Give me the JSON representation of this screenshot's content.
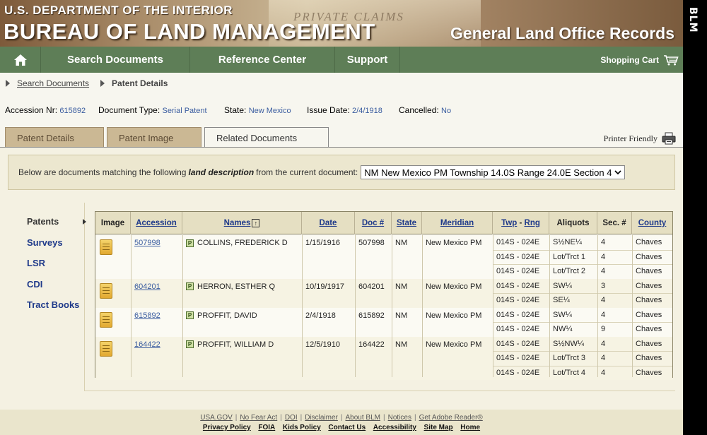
{
  "header": {
    "department": "U.S. DEPARTMENT OF THE INTERIOR",
    "bureau": "BUREAU OF LAND MANAGEMENT",
    "site": "General Land Office Records",
    "background_script": "PRIVATE CLAIMS"
  },
  "side_mark": "BLM",
  "nav": {
    "home_icon": "house-icon",
    "items": [
      "Search Documents",
      "Reference Center",
      "Support"
    ],
    "cart": "Shopping Cart"
  },
  "breadcrumb": {
    "link": "Search Documents",
    "current": "Patent Details"
  },
  "meta": {
    "accession_label": "Accession Nr:",
    "accession": "615892",
    "doctype_label": "Document Type:",
    "doctype": "Serial Patent",
    "state_label": "State:",
    "state": "New Mexico",
    "issue_label": "Issue Date:",
    "issue": "2/4/1918",
    "cancelled_label": "Cancelled:",
    "cancelled": "No"
  },
  "tabs": [
    "Patent Details",
    "Patent Image",
    "Related Documents"
  ],
  "printer_friendly": "Printer Friendly",
  "land_description": {
    "prefix": "Below are documents matching the following",
    "emphasis": "land description",
    "suffix": "from the current document:",
    "selected": "NM New Mexico PM Township 14.0S Range 24.0E Section 4"
  },
  "sidenav": [
    "Patents",
    "Surveys",
    "LSR",
    "CDI",
    "Tract Books"
  ],
  "table": {
    "headers": {
      "image": "Image",
      "accession": "Accession",
      "names": "Names",
      "date": "Date",
      "doc": "Doc #",
      "state": "State",
      "meridian": "Meridian",
      "twp": "Twp",
      "twp_sep": " - ",
      "rng": "Rng",
      "aliquots": "Aliquots",
      "sec": "Sec. #",
      "county": "County"
    },
    "badge": "P",
    "groups": [
      {
        "accession": "507998",
        "name": "COLLINS, FREDERICK D",
        "date": "1/15/1916",
        "doc": "507998",
        "state": "NM",
        "meridian": "New Mexico PM",
        "rows": [
          {
            "twp": "014S - 024E",
            "aliquot": "S½NE¼",
            "sec": "4",
            "county": "Chaves"
          },
          {
            "twp": "014S - 024E",
            "aliquot": "Lot/Trct 1",
            "sec": "4",
            "county": "Chaves"
          },
          {
            "twp": "014S - 024E",
            "aliquot": "Lot/Trct 2",
            "sec": "4",
            "county": "Chaves"
          }
        ]
      },
      {
        "accession": "604201",
        "name": "HERRON, ESTHER Q",
        "date": "10/19/1917",
        "doc": "604201",
        "state": "NM",
        "meridian": "New Mexico PM",
        "rows": [
          {
            "twp": "014S - 024E",
            "aliquot": "SW¼",
            "sec": "3",
            "county": "Chaves"
          },
          {
            "twp": "014S - 024E",
            "aliquot": "SE¼",
            "sec": "4",
            "county": "Chaves"
          }
        ]
      },
      {
        "accession": "615892",
        "name": "PROFFIT, DAVID",
        "date": "2/4/1918",
        "doc": "615892",
        "state": "NM",
        "meridian": "New Mexico PM",
        "rows": [
          {
            "twp": "014S - 024E",
            "aliquot": "SW¼",
            "sec": "4",
            "county": "Chaves"
          },
          {
            "twp": "014S - 024E",
            "aliquot": "NW¼",
            "sec": "9",
            "county": "Chaves"
          }
        ]
      },
      {
        "accession": "164422",
        "name": "PROFFIT, WILLIAM D",
        "date": "12/5/1910",
        "doc": "164422",
        "state": "NM",
        "meridian": "New Mexico PM",
        "rows": [
          {
            "twp": "014S - 024E",
            "aliquot": "S½NW¼",
            "sec": "4",
            "county": "Chaves"
          },
          {
            "twp": "014S - 024E",
            "aliquot": "Lot/Trct 3",
            "sec": "4",
            "county": "Chaves"
          },
          {
            "twp": "014S - 024E",
            "aliquot": "Lot/Trct 4",
            "sec": "4",
            "county": "Chaves"
          }
        ]
      }
    ]
  },
  "footer": {
    "row1": [
      "USA.GOV",
      "No Fear Act",
      "DOI",
      "Disclaimer",
      "About BLM",
      "Notices",
      "Get Adobe Reader®"
    ],
    "row2": [
      "Privacy Policy",
      "FOIA",
      "Kids Policy",
      "Contact Us",
      "Accessibility",
      "Site Map",
      "Home"
    ]
  }
}
